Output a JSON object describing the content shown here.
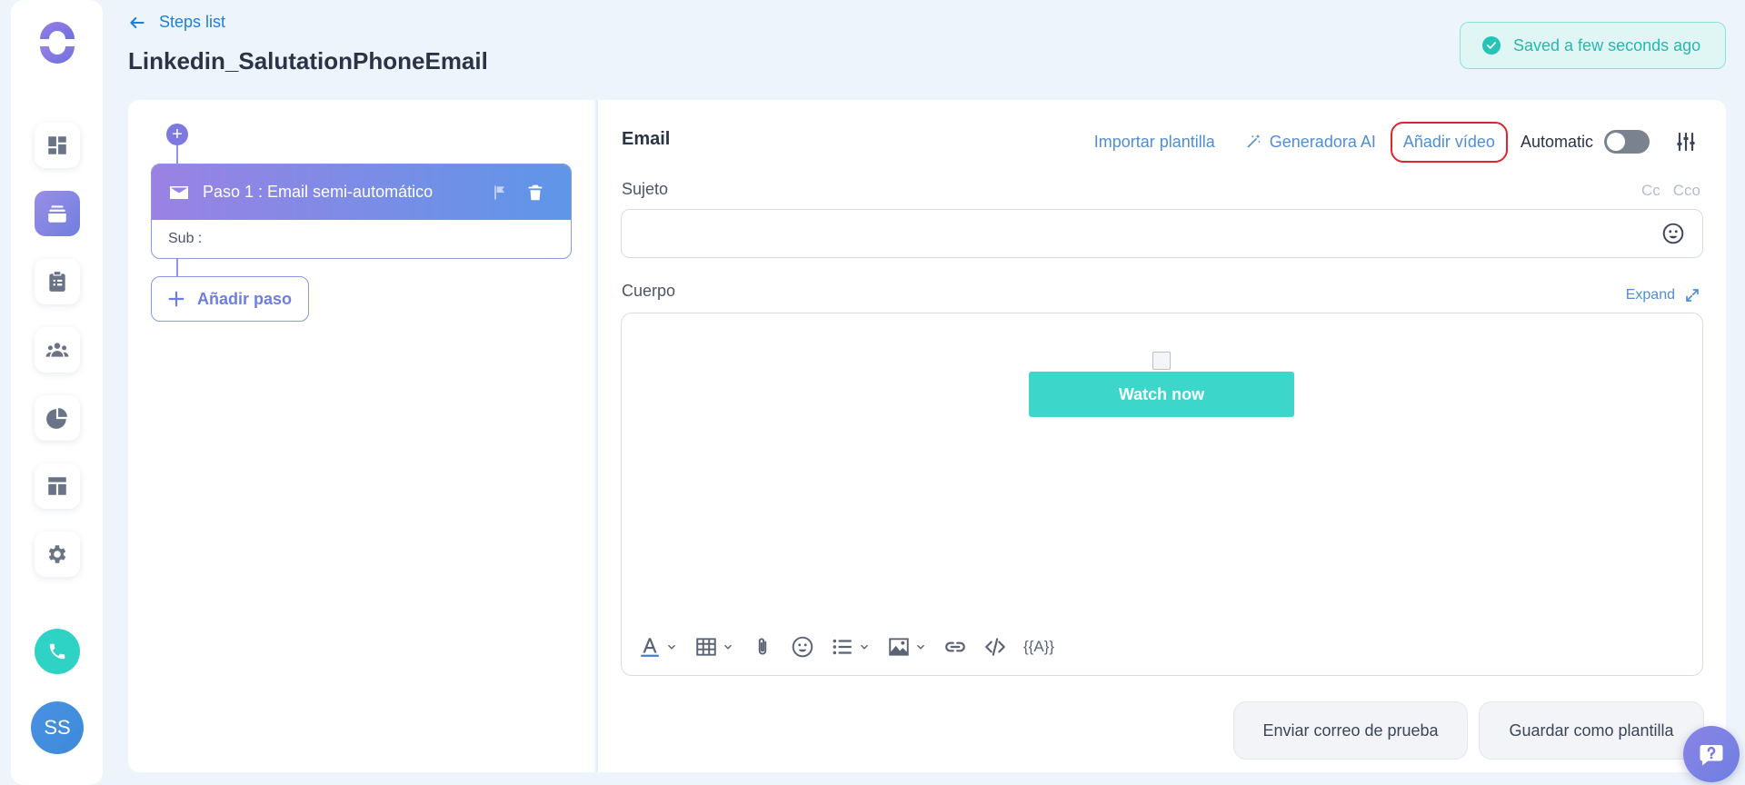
{
  "header": {
    "back_label": "Steps list",
    "title": "Linkedin_SalutationPhoneEmail",
    "saved_status": "Saved a few seconds ago"
  },
  "sidebar": {
    "items": [
      {
        "icon": "dashboard-icon"
      },
      {
        "icon": "sequences-icon",
        "active": true
      },
      {
        "icon": "tasks-icon"
      },
      {
        "icon": "contacts-icon"
      },
      {
        "icon": "reports-icon"
      },
      {
        "icon": "templates-icon"
      },
      {
        "icon": "settings-icon"
      }
    ],
    "avatar_initials": "SS"
  },
  "steps": {
    "step1_title": "Paso 1 : Email semi-automático",
    "step1_sub": "Sub :",
    "add_step_label": "Añadir paso"
  },
  "editor": {
    "type_label": "Email",
    "import_template": "Importar plantilla",
    "ai_generator": "Generadora AI",
    "add_video": "Añadir vídeo",
    "automatic_label": "Automatic",
    "automatic_on": false,
    "subject_label": "Sujeto",
    "subject_value": "",
    "cc_label": "Cc",
    "cco_label": "Cco",
    "body_label": "Cuerpo",
    "expand_label": "Expand",
    "watch_now": "Watch now",
    "variable_tool": "{{A}}"
  },
  "footer": {
    "send_test": "Enviar correo de prueba",
    "save_template": "Guardar como plantilla"
  },
  "colors": {
    "accent": "#1f7ed8",
    "brand_purple": "#7d79e0",
    "teal": "#3dd6cb",
    "highlight_red": "#e0262c"
  }
}
